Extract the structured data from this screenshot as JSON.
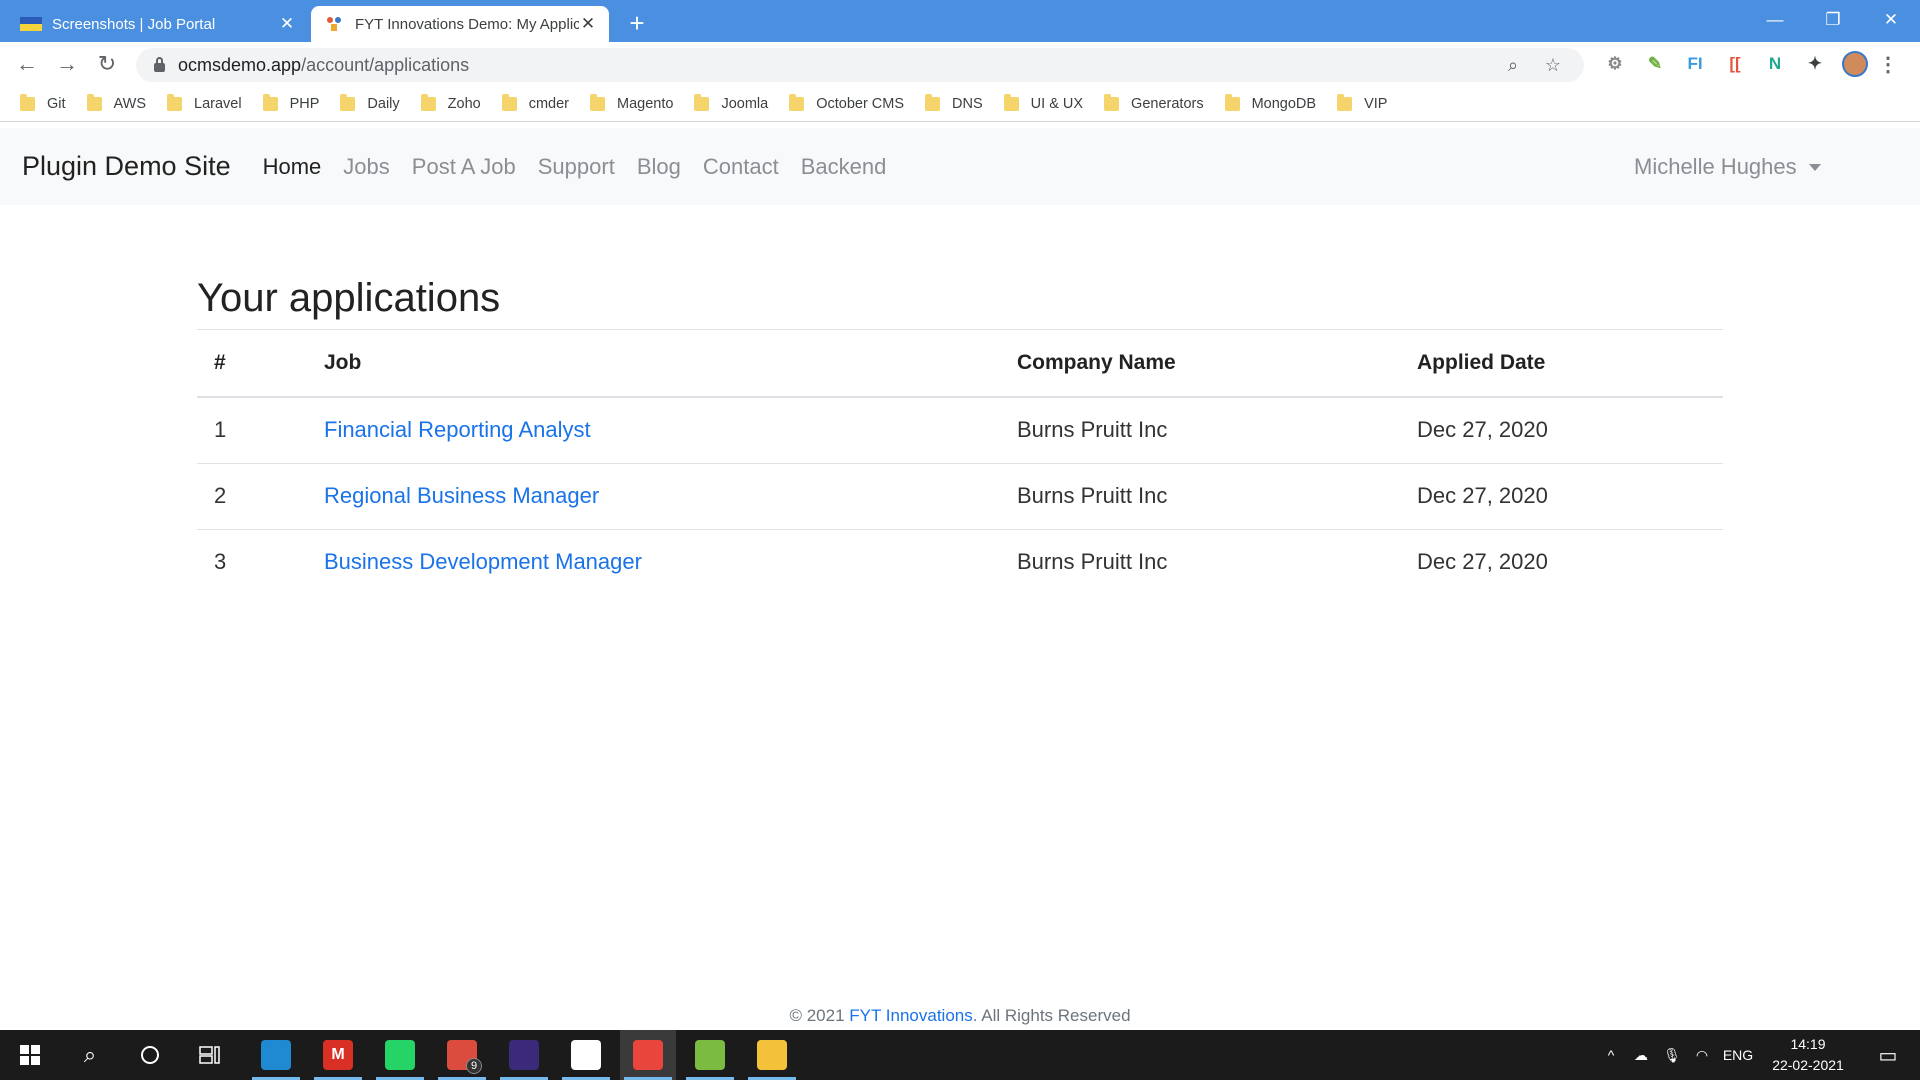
{
  "browser": {
    "tabs": [
      {
        "title": "Screenshots | Job Portal",
        "active": false,
        "favicon": "ukraine-flag-icon"
      },
      {
        "title": "FYT Innovations Demo: My Applic",
        "active": true,
        "favicon": "fyt-logo-icon"
      }
    ],
    "url_host": "ocmsdemo.app",
    "url_path": "/account/applications",
    "bookmarks": [
      "Git",
      "AWS",
      "Laravel",
      "PHP",
      "Daily",
      "Zoho",
      "cmder",
      "Magento",
      "Joomla",
      "October CMS",
      "DNS",
      "UI & UX",
      "Generators",
      "MongoDB",
      "VIP"
    ],
    "extensions": [
      {
        "icon": "gear-extension-icon",
        "label": "",
        "color": "#888888"
      },
      {
        "icon": "eyedropper-extension-icon",
        "label": "",
        "color": "#6fae3f"
      },
      {
        "icon": "fi-extension-icon",
        "label": "FI",
        "color": "#3b9be0"
      },
      {
        "icon": "bracket-extension-icon",
        "label": "[[",
        "color": "#e8533c"
      },
      {
        "icon": "n-extension-icon",
        "label": "N",
        "color": "#1fa98d"
      },
      {
        "icon": "puzzle-extensions-icon",
        "label": "",
        "color": "#3c4043"
      }
    ]
  },
  "site": {
    "brand": "Plugin Demo Site",
    "nav": [
      "Home",
      "Jobs",
      "Post A Job",
      "Support",
      "Blog",
      "Contact",
      "Backend"
    ],
    "active_nav": "Home",
    "user": "Michelle Hughes"
  },
  "page": {
    "title": "Your applications",
    "columns": [
      "#",
      "Job",
      "Company Name",
      "Applied Date"
    ],
    "rows": [
      {
        "num": "1",
        "job": "Financial Reporting Analyst",
        "company": "Burns Pruitt Inc",
        "date": "Dec 27, 2020"
      },
      {
        "num": "2",
        "job": "Regional Business Manager",
        "company": "Burns Pruitt Inc",
        "date": "Dec 27, 2020"
      },
      {
        "num": "3",
        "job": "Business Development Manager",
        "company": "Burns Pruitt Inc",
        "date": "Dec 27, 2020"
      }
    ]
  },
  "footer": {
    "prefix": "© 2021 ",
    "link": "FYT Innovations",
    "suffix": ". All Rights Reserved"
  },
  "taskbar": {
    "apps": [
      {
        "name": "vscode",
        "icon": "vscode-icon",
        "label": "",
        "color": "#1f8ad2",
        "open": true,
        "active": false,
        "badge": ""
      },
      {
        "name": "gmail",
        "icon": "gmail-icon",
        "label": "M",
        "color": "#d93025",
        "open": true,
        "active": false,
        "badge": ""
      },
      {
        "name": "whatsapp",
        "icon": "whatsapp-icon",
        "label": "",
        "color": "#25d366",
        "open": true,
        "active": false,
        "badge": ""
      },
      {
        "name": "todoist",
        "icon": "todoist-icon",
        "label": "",
        "color": "#db4c3f",
        "open": true,
        "active": false,
        "badge": "9"
      },
      {
        "name": "app-purple",
        "icon": "purple-app-icon",
        "label": "",
        "color": "#3b2a7a",
        "open": true,
        "active": false,
        "badge": ""
      },
      {
        "name": "app-bw",
        "icon": "bw-app-icon",
        "label": "",
        "color": "#ffffff",
        "open": true,
        "active": false,
        "badge": ""
      },
      {
        "name": "chrome",
        "icon": "chrome-icon",
        "label": "",
        "color": "#e8453c",
        "open": true,
        "active": true,
        "badge": ""
      },
      {
        "name": "terminal",
        "icon": "terminal-icon",
        "label": "",
        "color": "#7cbb42",
        "open": true,
        "active": false,
        "badge": ""
      },
      {
        "name": "explorer",
        "icon": "file-explorer-icon",
        "label": "",
        "color": "#f3c13a",
        "open": true,
        "active": false,
        "badge": ""
      }
    ],
    "language": "ENG",
    "time": "14:19",
    "date": "22-02-2021"
  },
  "colors": {
    "chrome_blue": "#4a8fe0",
    "link_blue": "#1a73e8",
    "navbar_bg": "#f8f9fa",
    "taskbar_bg": "#1b1b1b"
  }
}
